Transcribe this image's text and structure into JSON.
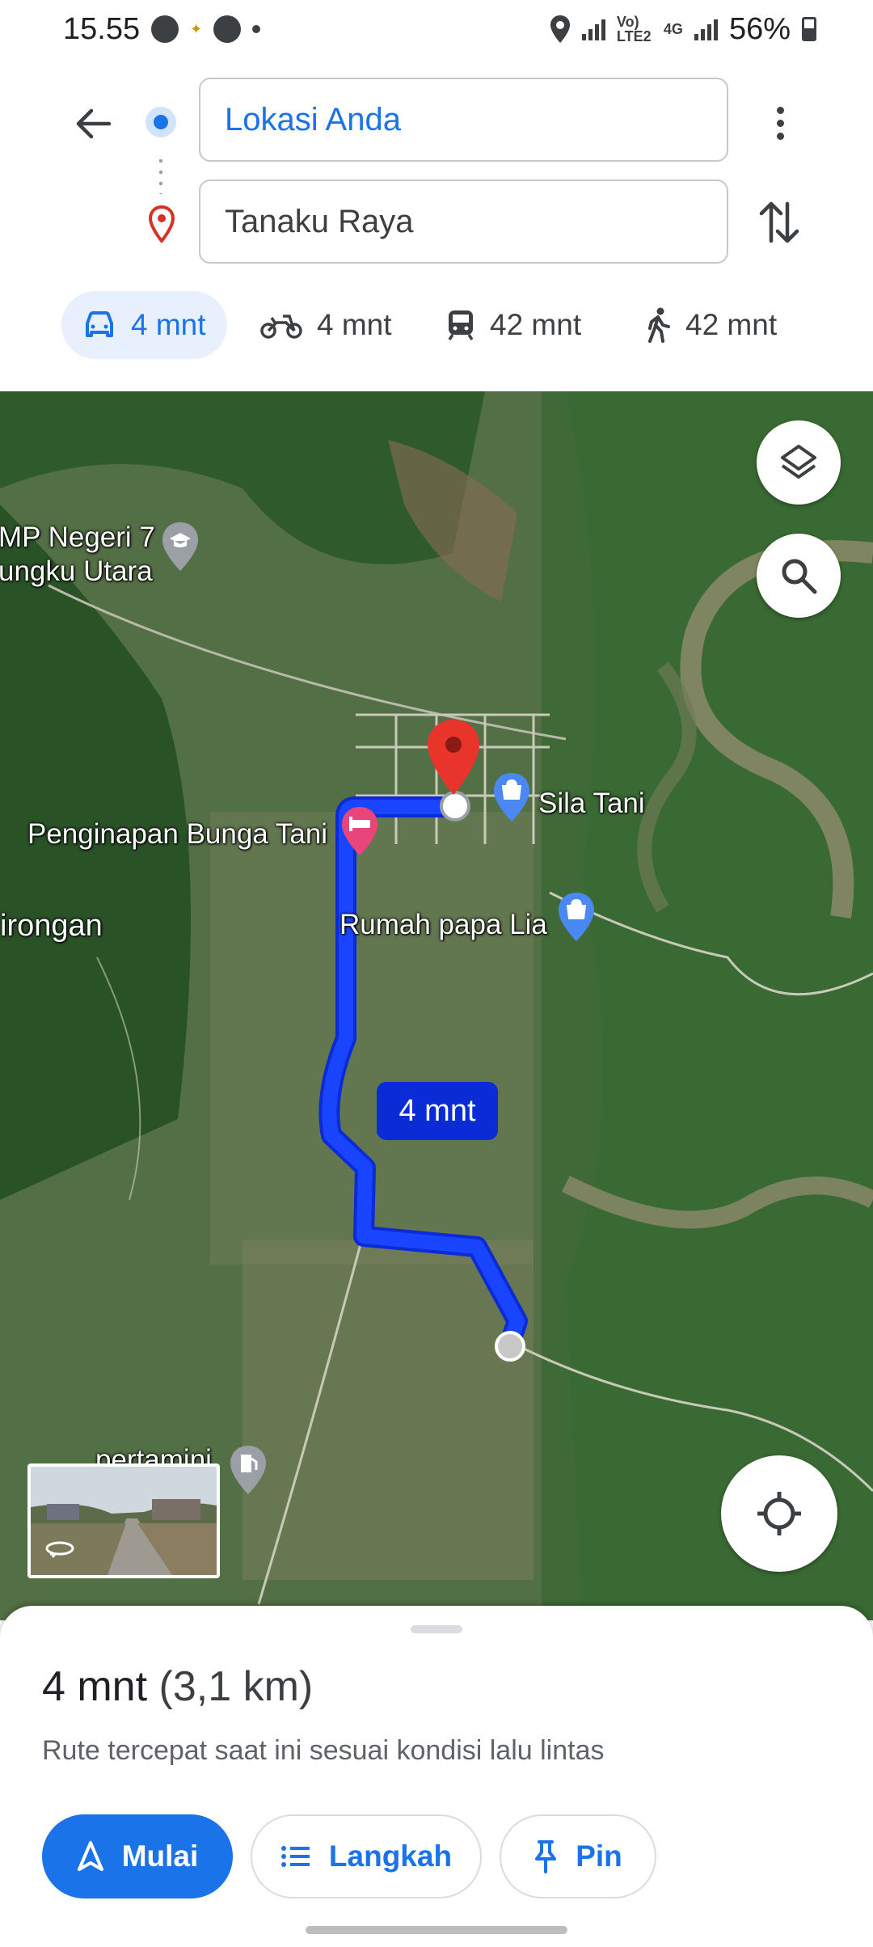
{
  "status_bar": {
    "time": "15.55",
    "volte_label": "Vo) LTE2",
    "network_label": "4G",
    "battery": "56%"
  },
  "route": {
    "from_value": "Lokasi Anda",
    "to_value": "Tanaku Raya"
  },
  "modes": [
    {
      "icon": "car-icon",
      "label": "4 mnt",
      "active": true
    },
    {
      "icon": "motorcycle-icon",
      "label": "4 mnt",
      "active": false
    },
    {
      "icon": "transit-icon",
      "label": "42 mnt",
      "active": false
    },
    {
      "icon": "walk-icon",
      "label": "42 mnt",
      "active": false
    }
  ],
  "map": {
    "labels": {
      "school": "MP Negeri 7\nungku Utara",
      "lodging": "Penginapan Bunga Tani",
      "shop1": "Sila Tani",
      "shop2": "Rumah papa Lia",
      "area": "irongan",
      "fuel": "pertamini"
    },
    "route_duration_bubble": "4 mnt",
    "route_color": "#1a45ff",
    "destination_pin_color": "#e8342a"
  },
  "sheet": {
    "duration": "4 mnt",
    "distance": "(3,1 km)",
    "description": "Rute tercepat saat ini sesuai kondisi lalu lintas",
    "start_label": "Mulai",
    "steps_label": "Langkah",
    "pin_label": "Pin"
  },
  "colors": {
    "accent": "#1a73e8",
    "active_chip_bg": "#e8f0fe"
  }
}
